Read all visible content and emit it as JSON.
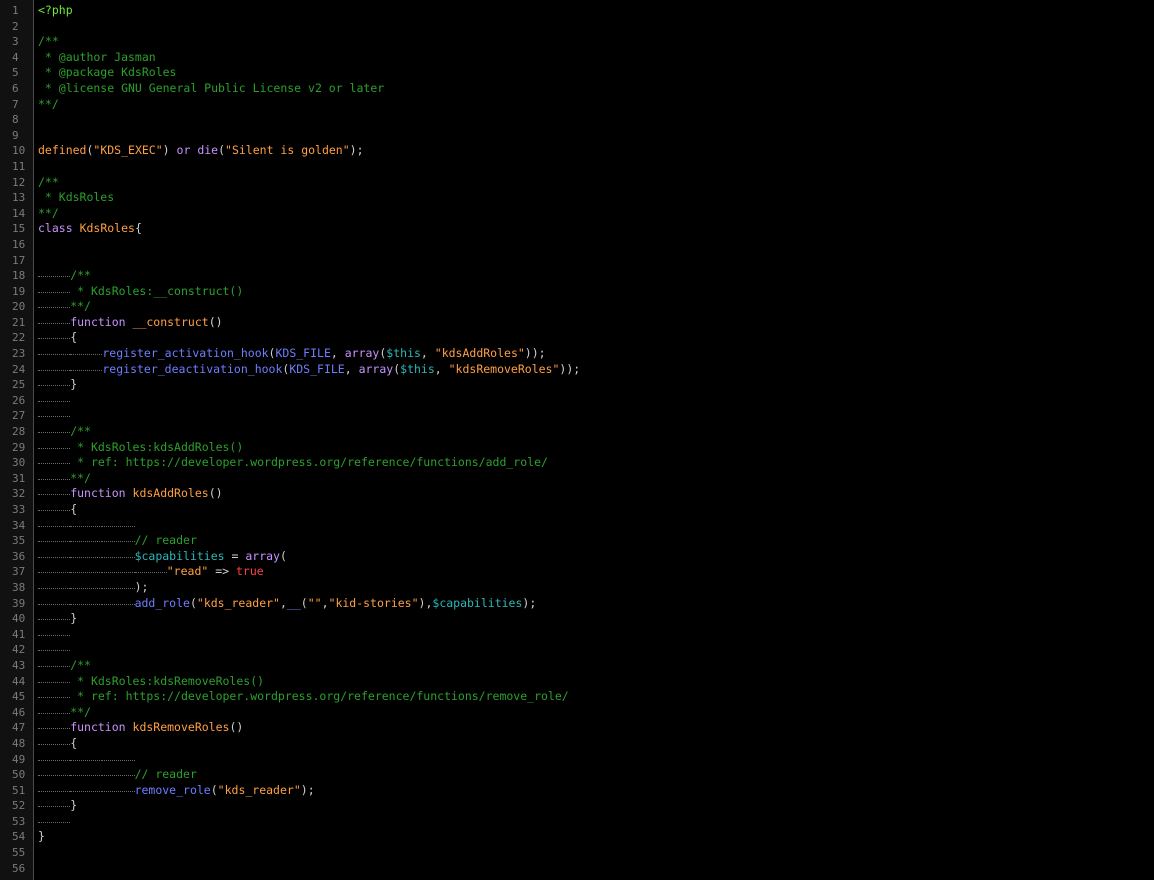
{
  "editor": {
    "lines": [
      {
        "n": "1",
        "indent": 0,
        "tokens": [
          {
            "t": "<?php",
            "c": "phptag"
          }
        ]
      },
      {
        "n": "2",
        "indent": 0,
        "tokens": []
      },
      {
        "n": "3",
        "indent": 0,
        "tokens": [
          {
            "t": "/**",
            "c": "cm"
          }
        ]
      },
      {
        "n": "4",
        "indent": 0,
        "tokens": [
          {
            "t": " * @author Jasman",
            "c": "cm"
          }
        ]
      },
      {
        "n": "5",
        "indent": 0,
        "tokens": [
          {
            "t": " * @package KdsRoles",
            "c": "cm"
          }
        ]
      },
      {
        "n": "6",
        "indent": 0,
        "tokens": [
          {
            "t": " * @license GNU General Public License v2 or later",
            "c": "cm"
          }
        ]
      },
      {
        "n": "7",
        "indent": 0,
        "tokens": [
          {
            "t": "**/",
            "c": "cm"
          }
        ]
      },
      {
        "n": "8",
        "indent": 0,
        "tokens": []
      },
      {
        "n": "9",
        "indent": 0,
        "tokens": []
      },
      {
        "n": "10",
        "indent": 0,
        "tokens": [
          {
            "t": "defined",
            "c": "fn"
          },
          {
            "t": "(",
            "c": "op"
          },
          {
            "t": "\"KDS_EXEC\"",
            "c": "str"
          },
          {
            "t": ") ",
            "c": "op"
          },
          {
            "t": "or",
            "c": "kw"
          },
          {
            "t": " ",
            "c": "op"
          },
          {
            "t": "die",
            "c": "kw"
          },
          {
            "t": "(",
            "c": "op"
          },
          {
            "t": "\"Silent is golden\"",
            "c": "str"
          },
          {
            "t": ");",
            "c": "op"
          }
        ]
      },
      {
        "n": "11",
        "indent": 0,
        "tokens": []
      },
      {
        "n": "12",
        "indent": 0,
        "tokens": [
          {
            "t": "/**",
            "c": "cm"
          }
        ]
      },
      {
        "n": "13",
        "indent": 0,
        "tokens": [
          {
            "t": " * KdsRoles",
            "c": "cm"
          }
        ]
      },
      {
        "n": "14",
        "indent": 0,
        "tokens": [
          {
            "t": "**/",
            "c": "cm"
          }
        ]
      },
      {
        "n": "15",
        "indent": 0,
        "tokens": [
          {
            "t": "class",
            "c": "kw"
          },
          {
            "t": " ",
            "c": "op"
          },
          {
            "t": "KdsRoles",
            "c": "cls"
          },
          {
            "t": "{",
            "c": "op"
          }
        ]
      },
      {
        "n": "16",
        "indent": 0,
        "tokens": []
      },
      {
        "n": "17",
        "indent": 0,
        "tokens": []
      },
      {
        "n": "18",
        "indent": 1,
        "tokens": [
          {
            "t": "/**",
            "c": "cm"
          }
        ]
      },
      {
        "n": "19",
        "indent": 1,
        "tokens": [
          {
            "t": " * KdsRoles:__construct()",
            "c": "cm"
          }
        ]
      },
      {
        "n": "20",
        "indent": 1,
        "tokens": [
          {
            "t": "**/",
            "c": "cm"
          }
        ]
      },
      {
        "n": "21",
        "indent": 1,
        "tokens": [
          {
            "t": "function",
            "c": "kw"
          },
          {
            "t": " ",
            "c": "op"
          },
          {
            "t": "__construct",
            "c": "fn"
          },
          {
            "t": "()",
            "c": "op"
          }
        ]
      },
      {
        "n": "22",
        "indent": 1,
        "tokens": [
          {
            "t": "{",
            "c": "op"
          }
        ]
      },
      {
        "n": "23",
        "indent": 2,
        "tokens": [
          {
            "t": "register_activation_hook",
            "c": "call"
          },
          {
            "t": "(",
            "c": "op"
          },
          {
            "t": "KDS_FILE",
            "c": "const"
          },
          {
            "t": ", ",
            "c": "op"
          },
          {
            "t": "array",
            "c": "kw"
          },
          {
            "t": "(",
            "c": "op"
          },
          {
            "t": "$this",
            "c": "var"
          },
          {
            "t": ", ",
            "c": "op"
          },
          {
            "t": "\"kdsAddRoles\"",
            "c": "str"
          },
          {
            "t": "));",
            "c": "op"
          }
        ]
      },
      {
        "n": "24",
        "indent": 2,
        "tokens": [
          {
            "t": "register_deactivation_hook",
            "c": "call"
          },
          {
            "t": "(",
            "c": "op"
          },
          {
            "t": "KDS_FILE",
            "c": "const"
          },
          {
            "t": ", ",
            "c": "op"
          },
          {
            "t": "array",
            "c": "kw"
          },
          {
            "t": "(",
            "c": "op"
          },
          {
            "t": "$this",
            "c": "var"
          },
          {
            "t": ", ",
            "c": "op"
          },
          {
            "t": "\"kdsRemoveRoles\"",
            "c": "str"
          },
          {
            "t": "));",
            "c": "op"
          }
        ]
      },
      {
        "n": "25",
        "indent": 1,
        "tokens": [
          {
            "t": "}",
            "c": "op"
          }
        ]
      },
      {
        "n": "26",
        "indent": 1,
        "tokens": []
      },
      {
        "n": "27",
        "indent": 1,
        "tokens": []
      },
      {
        "n": "28",
        "indent": 1,
        "tokens": [
          {
            "t": "/**",
            "c": "cm"
          }
        ]
      },
      {
        "n": "29",
        "indent": 1,
        "tokens": [
          {
            "t": " * KdsRoles:kdsAddRoles()",
            "c": "cm"
          }
        ]
      },
      {
        "n": "30",
        "indent": 1,
        "tokens": [
          {
            "t": " * ref: https://developer.wordpress.org/reference/functions/add_role/",
            "c": "cm"
          }
        ]
      },
      {
        "n": "31",
        "indent": 1,
        "tokens": [
          {
            "t": "**/",
            "c": "cm"
          }
        ]
      },
      {
        "n": "32",
        "indent": 1,
        "tokens": [
          {
            "t": "function",
            "c": "kw"
          },
          {
            "t": " ",
            "c": "op"
          },
          {
            "t": "kdsAddRoles",
            "c": "fn"
          },
          {
            "t": "()",
            "c": "op"
          }
        ]
      },
      {
        "n": "33",
        "indent": 1,
        "tokens": [
          {
            "t": "{",
            "c": "op"
          }
        ]
      },
      {
        "n": "34",
        "indent": 3,
        "tokens": []
      },
      {
        "n": "35",
        "indent": 3,
        "tokens": [
          {
            "t": "// reader",
            "c": "cm"
          }
        ]
      },
      {
        "n": "36",
        "indent": 3,
        "tokens": [
          {
            "t": "$capabilities",
            "c": "var"
          },
          {
            "t": " = ",
            "c": "op"
          },
          {
            "t": "array",
            "c": "kw"
          },
          {
            "t": "(",
            "c": "op"
          }
        ]
      },
      {
        "n": "37",
        "indent": 4,
        "tokens": [
          {
            "t": "\"read\"",
            "c": "str"
          },
          {
            "t": " => ",
            "c": "op"
          },
          {
            "t": "true",
            "c": "bool"
          }
        ]
      },
      {
        "n": "38",
        "indent": 3,
        "tokens": [
          {
            "t": ");",
            "c": "op"
          }
        ]
      },
      {
        "n": "39",
        "indent": 3,
        "tokens": [
          {
            "t": "add_role",
            "c": "call"
          },
          {
            "t": "(",
            "c": "op"
          },
          {
            "t": "\"kds_reader\"",
            "c": "str"
          },
          {
            "t": ",",
            "c": "op"
          },
          {
            "t": "__",
            "c": "call"
          },
          {
            "t": "(",
            "c": "op"
          },
          {
            "t": "\"\"",
            "c": "str"
          },
          {
            "t": ",",
            "c": "op"
          },
          {
            "t": "\"kid-stories\"",
            "c": "str"
          },
          {
            "t": "),",
            "c": "op"
          },
          {
            "t": "$capabilities",
            "c": "var"
          },
          {
            "t": ");",
            "c": "op"
          }
        ]
      },
      {
        "n": "40",
        "indent": 1,
        "tokens": [
          {
            "t": "}",
            "c": "op"
          }
        ]
      },
      {
        "n": "41",
        "indent": 1,
        "tokens": []
      },
      {
        "n": "42",
        "indent": 1,
        "tokens": []
      },
      {
        "n": "43",
        "indent": 1,
        "tokens": [
          {
            "t": "/**",
            "c": "cm"
          }
        ]
      },
      {
        "n": "44",
        "indent": 1,
        "tokens": [
          {
            "t": " * KdsRoles:kdsRemoveRoles()",
            "c": "cm"
          }
        ]
      },
      {
        "n": "45",
        "indent": 1,
        "tokens": [
          {
            "t": " * ref: https://developer.wordpress.org/reference/functions/remove_role/",
            "c": "cm"
          }
        ]
      },
      {
        "n": "46",
        "indent": 1,
        "tokens": [
          {
            "t": "**/",
            "c": "cm"
          }
        ]
      },
      {
        "n": "47",
        "indent": 1,
        "tokens": [
          {
            "t": "function",
            "c": "kw"
          },
          {
            "t": " ",
            "c": "op"
          },
          {
            "t": "kdsRemoveRoles",
            "c": "fn"
          },
          {
            "t": "()",
            "c": "op"
          }
        ]
      },
      {
        "n": "48",
        "indent": 1,
        "tokens": [
          {
            "t": "{",
            "c": "op"
          }
        ]
      },
      {
        "n": "49",
        "indent": 3,
        "tokens": []
      },
      {
        "n": "50",
        "indent": 3,
        "tokens": [
          {
            "t": "// reader",
            "c": "cm"
          }
        ]
      },
      {
        "n": "51",
        "indent": 3,
        "tokens": [
          {
            "t": "remove_role",
            "c": "call"
          },
          {
            "t": "(",
            "c": "op"
          },
          {
            "t": "\"kds_reader\"",
            "c": "str"
          },
          {
            "t": ");",
            "c": "op"
          }
        ]
      },
      {
        "n": "52",
        "indent": 1,
        "tokens": [
          {
            "t": "}",
            "c": "op"
          }
        ]
      },
      {
        "n": "53",
        "indent": 1,
        "tokens": []
      },
      {
        "n": "54",
        "indent": 0,
        "tokens": [
          {
            "t": "}",
            "c": "op"
          }
        ]
      },
      {
        "n": "55",
        "indent": 0,
        "tokens": []
      },
      {
        "n": "56",
        "indent": 0,
        "tokens": []
      }
    ]
  },
  "theme": {
    "background": "#000000",
    "gutter_background": "#111111",
    "keyword": "#c792ff",
    "comment": "#2ca02c",
    "string": "#ff9f43",
    "call": "#6f7dff",
    "variable": "#2bb7b7",
    "boolean": "#ff4040"
  }
}
